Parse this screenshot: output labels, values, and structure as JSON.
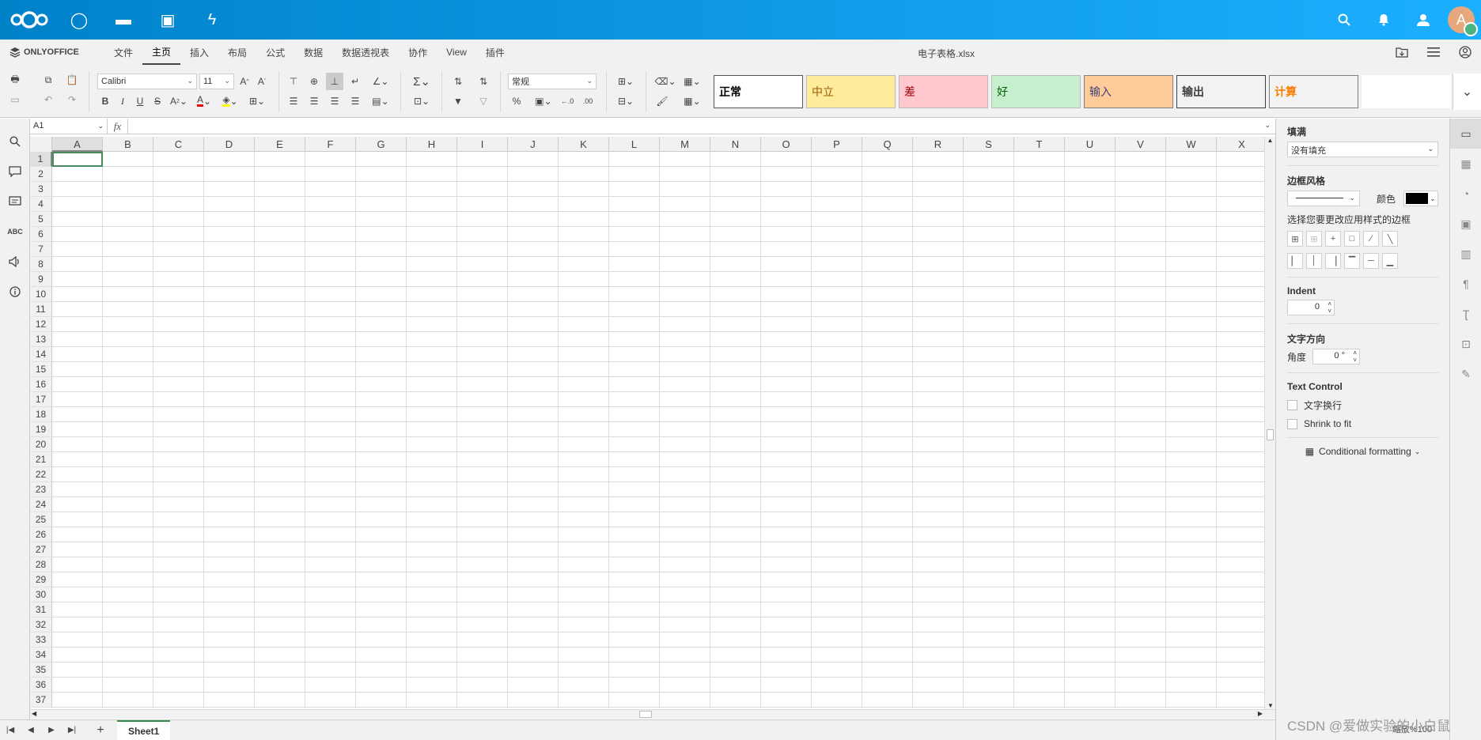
{
  "nextcloud": {
    "apps": [
      {
        "name": "dashboard-icon",
        "glyph": "◯"
      },
      {
        "name": "files-icon",
        "glyph": "▬"
      },
      {
        "name": "photos-icon",
        "glyph": "▣"
      },
      {
        "name": "activity-icon",
        "glyph": "ϟ"
      }
    ],
    "avatar_letter": "A"
  },
  "menubar": {
    "brand": "ONLYOFFICE",
    "tabs": [
      "文件",
      "主页",
      "插入",
      "布局",
      "公式",
      "数据",
      "数据透视表",
      "协作",
      "View",
      "插件"
    ],
    "active_tab": 1,
    "doc_title": "电子表格.xlsx"
  },
  "toolbar": {
    "font_name": "Calibri",
    "font_size": "11",
    "number_format": "常规",
    "bold": "B",
    "italic": "I",
    "underline": "U",
    "strike": "S",
    "percent": "%",
    "sigma": "Σ"
  },
  "cell_styles": [
    {
      "label": "正常",
      "bg": "#ffffff",
      "fg": "#000000",
      "bold": true,
      "border": "#555555"
    },
    {
      "label": "中立",
      "bg": "#ffeb9c",
      "fg": "#9c5700",
      "bold": false,
      "border": "#bbbbbb"
    },
    {
      "label": "差",
      "bg": "#ffc7ce",
      "fg": "#9c0006",
      "bold": false,
      "border": "#bbbbbb"
    },
    {
      "label": "好",
      "bg": "#c6efce",
      "fg": "#006100",
      "bold": false,
      "border": "#bbbbbb"
    },
    {
      "label": "输入",
      "bg": "#ffcc99",
      "fg": "#3f3f76",
      "bold": false,
      "border": "#7f7f7f"
    },
    {
      "label": "输出",
      "bg": "#f2f2f2",
      "fg": "#3f3f3f",
      "bold": true,
      "border": "#3f3f3f"
    },
    {
      "label": "计算",
      "bg": "#f2f2f2",
      "fg": "#fa7d00",
      "bold": true,
      "border": "#7f7f7f"
    },
    {
      "label": "",
      "bg": "#ffffff",
      "fg": "#000000",
      "bold": false,
      "border": "#ffffff"
    }
  ],
  "formula_bar": {
    "name_box": "A1",
    "fx": "fx",
    "formula": ""
  },
  "sheet": {
    "columns": [
      "A",
      "B",
      "C",
      "D",
      "E",
      "F",
      "G",
      "H",
      "I",
      "J",
      "K",
      "L",
      "M",
      "N",
      "O",
      "P",
      "Q",
      "R",
      "S",
      "T",
      "U",
      "V",
      "W",
      "X"
    ],
    "row_count": 37,
    "active_cell": "A1",
    "tabs": [
      "Sheet1"
    ],
    "active_tab": "Sheet1"
  },
  "panel": {
    "fill_label": "填满",
    "fill_value": "没有填充",
    "border_style_label": "边框风格",
    "color_label": "颜色",
    "border_color": "#000000",
    "border_hint": "选择您要更改应用样式的边框",
    "indent_label": "Indent",
    "indent_value": "0",
    "text_direction_label": "文字方向",
    "angle_label": "角度",
    "angle_value": "0 °",
    "text_control_label": "Text Control",
    "wrap_label": "文字换行",
    "shrink_label": "Shrink to fit",
    "conditional_label": "Conditional formatting"
  },
  "status": {
    "zoom": "缩放%100"
  },
  "watermark": "CSDN @爱做实验的小白鼠"
}
